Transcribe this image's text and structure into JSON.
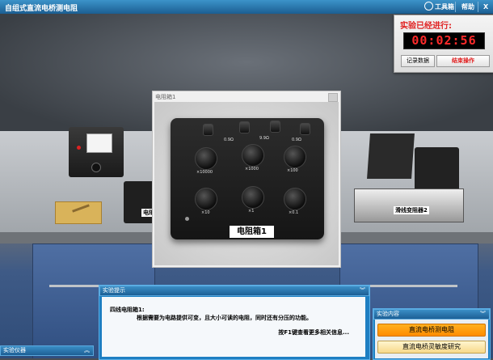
{
  "titlebar": {
    "title": "自组式直流电桥测电阻",
    "toolbox_label": "工具箱",
    "help_label": "帮助",
    "close_label": "X"
  },
  "timer": {
    "label": "实验已经进行:",
    "time": "00:02:56",
    "record_button": "记录数据",
    "end_button": "结束操作"
  },
  "popup": {
    "title": "电阻箱1",
    "device_label": "电阻箱1",
    "knob_scales": [
      "×10000",
      "×1000",
      "×100",
      "×10",
      "×1",
      "×0.1"
    ],
    "small_labels": [
      "0.9Ω",
      "9.9Ω",
      "0.9Ω"
    ]
  },
  "scene_labels": {
    "resistor_box_left": "电阻",
    "rheostat": "滑线变阻器2"
  },
  "tips": {
    "title": "实验提示",
    "line1": "四线电阻箱1:",
    "line2": "根据需要为电路提供可变，且大小可读的电阻，同时还有分压的功能。",
    "line3": "按F1键查看更多相关信息..."
  },
  "content_panel": {
    "title": "实验内容",
    "items": [
      "直流电桥测电阻",
      "直流电桥灵敏度研究"
    ]
  },
  "instruments_panel": {
    "title": "实验仪器"
  },
  "colors": {
    "title_bar": "#1b5e92",
    "timer_digits": "#ff2a2a",
    "active_item": "#ff8c00"
  }
}
